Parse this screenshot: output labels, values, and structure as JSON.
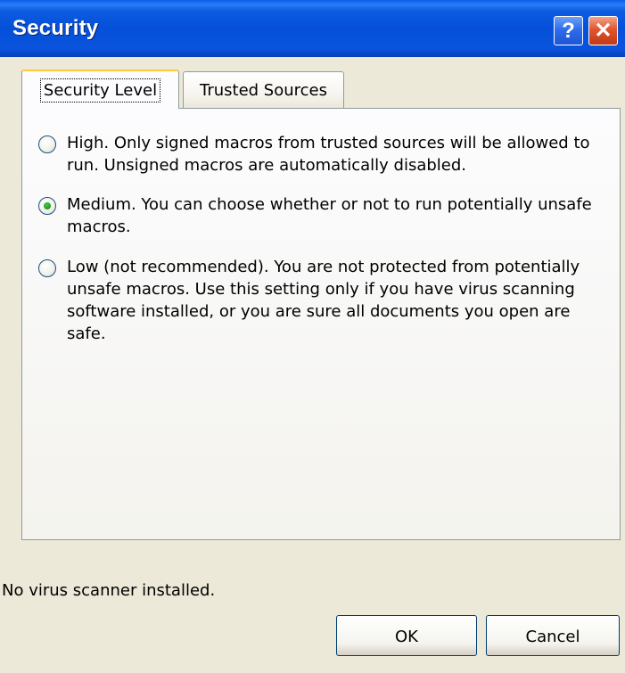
{
  "window": {
    "title": "Security",
    "help_glyph": "?",
    "close_glyph": "✕"
  },
  "tabs": [
    {
      "label": "Security Level",
      "active": true
    },
    {
      "label": "Trusted Sources",
      "active": false
    }
  ],
  "options": [
    {
      "text": "High. Only signed macros from trusted sources will be allowed to run. Unsigned macros are automatically disabled.",
      "selected": false
    },
    {
      "text": "Medium. You can choose whether or not to run potentially unsafe macros.",
      "selected": true
    },
    {
      "text": "Low (not recommended). You are not protected from potentially unsafe macros. Use this setting only if you have virus scanning software installed, or you are sure all documents you open are safe.",
      "selected": false
    }
  ],
  "status_text": "No virus scanner installed.",
  "buttons": {
    "ok_label": "OK",
    "cancel_label": "Cancel"
  },
  "colors": {
    "titlebar": "#0550D9",
    "dialog_bg": "#ECE9D8",
    "active_tab_accent": "#FFC83C",
    "radio_selected": "#21A121"
  }
}
